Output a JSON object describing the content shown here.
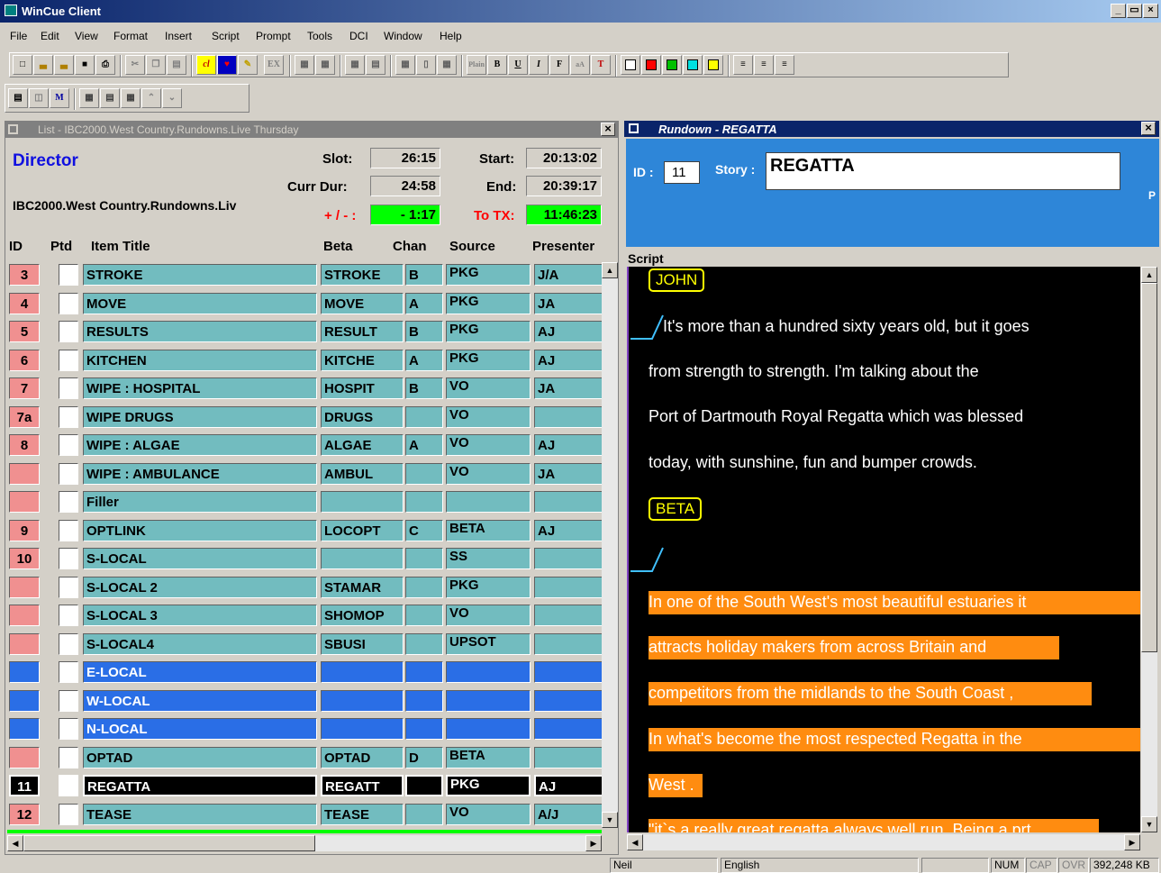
{
  "window": {
    "title": "WinCue Client"
  },
  "menu": [
    "File",
    "Edit",
    "View",
    "Format",
    "Insert",
    "Script",
    "Prompt",
    "Tools",
    "DCI",
    "Window",
    "Help"
  ],
  "toolbar": {
    "plain": "Plain",
    "bold": "B",
    "underline": "U",
    "italic": "I",
    "ex": "EX"
  },
  "list_panel": {
    "title": "List - IBC2000.West Country.Rundowns.Live Thursday",
    "role": "Director",
    "path": "IBC2000.West Country.Rundowns.Liv",
    "slot_label": "Slot:",
    "slot": "26:15",
    "start_label": "Start:",
    "start": "20:13:02",
    "currdur_label": "Curr Dur:",
    "currdur": "24:58",
    "end_label": "End:",
    "end": "20:39:17",
    "plusminus_label": "+ / - :",
    "plusminus": "- 1:17",
    "totx_label": "To TX:",
    "totx": "11:46:23",
    "headers": {
      "id": "ID",
      "ptd": "Ptd",
      "title": "Item Title",
      "beta": "Beta",
      "chan": "Chan",
      "source": "Source",
      "presenter": "Presenter"
    },
    "rows": [
      {
        "id": "3",
        "title": "STROKE",
        "beta": "STROKE",
        "chan": "B",
        "source": "PKG",
        "presenter": "J/A",
        "style": ""
      },
      {
        "id": "4",
        "title": "MOVE",
        "beta": "MOVE",
        "chan": "A",
        "source": "PKG",
        "presenter": "JA",
        "style": ""
      },
      {
        "id": "5",
        "title": "RESULTS",
        "beta": "RESULT",
        "chan": "B",
        "source": "PKG",
        "presenter": "AJ",
        "style": ""
      },
      {
        "id": "6",
        "title": "KITCHEN",
        "beta": "KITCHE",
        "chan": "A",
        "source": "PKG",
        "presenter": "AJ",
        "style": ""
      },
      {
        "id": "7",
        "title": "WIPE : HOSPITAL",
        "beta": "HOSPIT",
        "chan": "B",
        "source": "VO",
        "presenter": "JA",
        "style": ""
      },
      {
        "id": "7a",
        "title": "WIPE DRUGS",
        "beta": "DRUGS",
        "chan": "",
        "source": "VO",
        "presenter": "",
        "style": ""
      },
      {
        "id": "8",
        "title": "WIPE : ALGAE",
        "beta": "ALGAE",
        "chan": "A",
        "source": "VO",
        "presenter": "AJ",
        "style": ""
      },
      {
        "id": "",
        "title": "WIPE : AMBULANCE",
        "beta": "AMBUL",
        "chan": "",
        "source": "VO",
        "presenter": "JA",
        "style": ""
      },
      {
        "id": "",
        "title": "Filler",
        "beta": "",
        "chan": "",
        "source": "",
        "presenter": "",
        "style": ""
      },
      {
        "id": "9",
        "title": "OPTLINK",
        "beta": "LOCOPT",
        "chan": "C",
        "source": "BETA",
        "presenter": "AJ",
        "style": ""
      },
      {
        "id": "10",
        "title": "S-LOCAL",
        "beta": "",
        "chan": "",
        "source": "SS",
        "presenter": "",
        "style": ""
      },
      {
        "id": "",
        "title": "S-LOCAL 2",
        "beta": "STAMAR",
        "chan": "",
        "source": "PKG",
        "presenter": "",
        "style": ""
      },
      {
        "id": "",
        "title": "S-LOCAL 3",
        "beta": "SHOMOP",
        "chan": "",
        "source": "VO",
        "presenter": "",
        "style": ""
      },
      {
        "id": "",
        "title": "S-LOCAL4",
        "beta": "SBUSI",
        "chan": "",
        "source": "UPSOT",
        "presenter": "",
        "style": ""
      },
      {
        "id": "",
        "title": "E-LOCAL",
        "beta": "",
        "chan": "",
        "source": "",
        "presenter": "",
        "style": "blue"
      },
      {
        "id": "",
        "title": "W-LOCAL",
        "beta": "",
        "chan": "",
        "source": "",
        "presenter": "",
        "style": "blue"
      },
      {
        "id": "",
        "title": "N-LOCAL",
        "beta": "",
        "chan": "",
        "source": "",
        "presenter": "",
        "style": "blue"
      },
      {
        "id": "",
        "title": "OPTAD",
        "beta": "OPTAD",
        "chan": "D",
        "source": "BETA",
        "presenter": "",
        "style": ""
      },
      {
        "id": "11",
        "title": "REGATTA",
        "beta": "REGATT",
        "chan": "",
        "source": "PKG",
        "presenter": "AJ",
        "style": "cur"
      },
      {
        "id": "12",
        "title": "TEASE",
        "beta": "TEASE",
        "chan": "",
        "source": "VO",
        "presenter": "A/J",
        "style": ""
      }
    ]
  },
  "rundown_panel": {
    "title": "Rundown - REGATTA",
    "id_label": "ID :",
    "id": "11",
    "story_label": "Story :",
    "story": "REGATTA",
    "script_label": "Script",
    "cue_john": "JOHN",
    "line1": "It's more than a hundred sixty years old, but it goes",
    "line2": "from strength to strength. I'm talking about the",
    "line3": " Port of Dartmouth Royal Regatta which was blessed",
    "line4": "today, with sunshine, fun and bumper crowds.",
    "cue_beta": "BETA",
    "o1": "In one of the South West's most beautiful estuaries  it",
    "o2": "attracts  holiday makers from across Britain and",
    "o3": "competitors  from  the midlands to the South Coast ,",
    "o4": "In what's become the most respected Regatta in the",
    "o5": "West .",
    "o6": "\"it`s  a really great regatta always well run. Being a prt"
  },
  "status": {
    "user": "Neil",
    "language": "English",
    "num": "NUM",
    "cap": "CAP",
    "ovr": "OVR",
    "memory": "392,248 KB"
  }
}
